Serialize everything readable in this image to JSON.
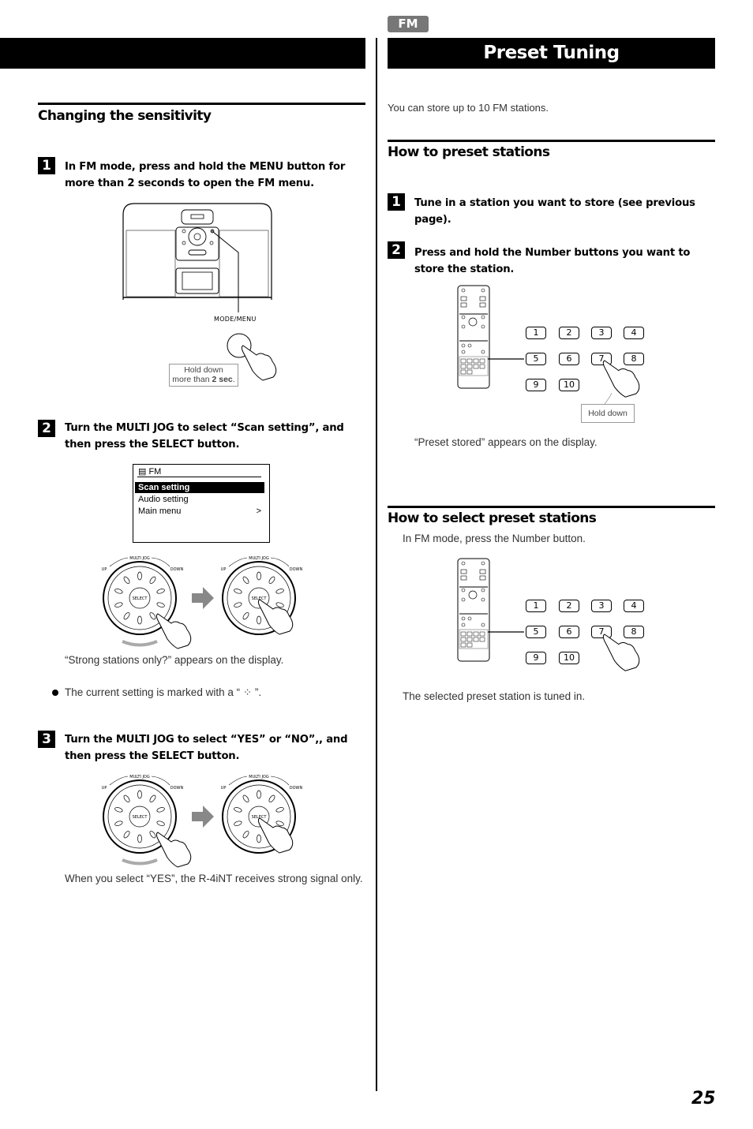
{
  "header": {
    "section_tag": "FM",
    "title": "Preset Tuning"
  },
  "left": {
    "heading": "Changing the sensitivity",
    "steps": [
      {
        "num": "1",
        "text": "In FM mode, press and hold the MENU button for more than 2 seconds to open the FM menu."
      },
      {
        "num": "2",
        "text": "Turn the MULTI JOG to select “Scan setting”, and then press the SELECT button."
      },
      {
        "num": "3",
        "text": "Turn the MULTI JOG to select “YES” or “NO”,, and then press the SELECT button."
      }
    ],
    "device_label": "MODE/MENU",
    "callout_line1": "Hold down",
    "callout_line2_prefix": "more than ",
    "callout_line2_bold": "2 sec",
    "callout_line2_suffix": ".",
    "lcd": {
      "header": "FM",
      "items": [
        {
          "label": "Scan setting",
          "selected": true,
          "arrow": ""
        },
        {
          "label": "Audio setting",
          "selected": false,
          "arrow": ""
        },
        {
          "label": "Main menu",
          "selected": false,
          "arrow": ">"
        }
      ]
    },
    "jog": {
      "title": "MULTI JOG",
      "up": "UP",
      "down": "DOWN",
      "center": "SELECT"
    },
    "step2_result": "“Strong stations only?” appears on the display.",
    "bullet_note": "The current setting is marked with a “ ⁘ ”.",
    "step3_result": "When you select “YES”, the R-4iNT receives strong signal only."
  },
  "right": {
    "intro": "You can store up to 10 FM stations.",
    "preset_heading": "How to preset stations",
    "preset_steps": [
      {
        "num": "1",
        "text": "Tune in a station you want to store (see previous page)."
      },
      {
        "num": "2",
        "text": "Press and hold the Number buttons you want to store the station."
      }
    ],
    "number_keys": [
      "1",
      "2",
      "3",
      "4",
      "5",
      "6",
      "7",
      "8",
      "9",
      "10"
    ],
    "hold_callout": "Hold down",
    "preset_result": "“Preset stored” appears on the display.",
    "select_heading": "How to select preset stations",
    "select_intro": "In FM mode, press the Number button.",
    "select_result": "The selected preset station is tuned in."
  },
  "page_number": "25"
}
